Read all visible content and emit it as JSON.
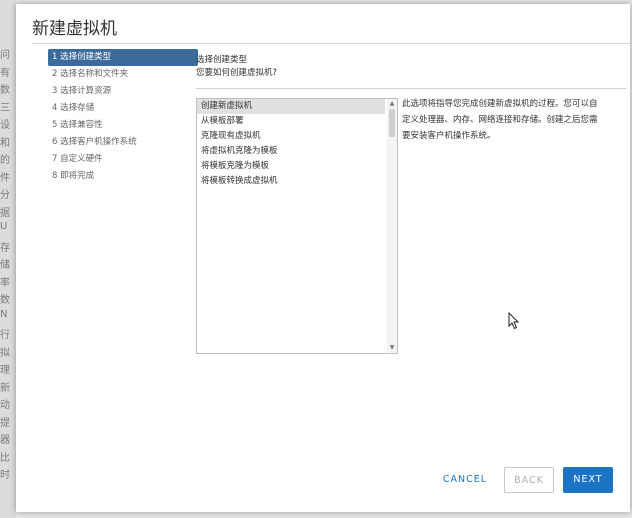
{
  "background_strip": [
    "问",
    "有",
    "数",
    "三",
    "设",
    "和",
    "的",
    "件",
    "分",
    "据",
    "U",
    "存",
    "储",
    "率",
    "数",
    "N",
    "行",
    "拟",
    "理",
    "新",
    "动",
    "提",
    "器",
    "比",
    "时"
  ],
  "dialog": {
    "title": "新建虚拟机"
  },
  "steps": [
    {
      "label": "1 选择创建类型",
      "active": true
    },
    {
      "label": "2 选择名称和文件夹",
      "active": false
    },
    {
      "label": "3 选择计算资源",
      "active": false
    },
    {
      "label": "4 选择存储",
      "active": false
    },
    {
      "label": "5 选择兼容性",
      "active": false
    },
    {
      "label": "6 选择客户机操作系统",
      "active": false
    },
    {
      "label": "7 自定义硬件",
      "active": false
    },
    {
      "label": "8 即将完成",
      "active": false
    }
  ],
  "content": {
    "title": "选择创建类型",
    "subtitle": "您要如何创建虚拟机?"
  },
  "creation_types": [
    {
      "label": "创建新虚拟机",
      "selected": true
    },
    {
      "label": "从模板部署",
      "selected": false
    },
    {
      "label": "克隆现有虚拟机",
      "selected": false
    },
    {
      "label": "将虚拟机克隆为模板",
      "selected": false
    },
    {
      "label": "将模板克隆为模板",
      "selected": false
    },
    {
      "label": "将模板转换成虚拟机",
      "selected": false
    }
  ],
  "description": "此选项将指导您完成创建新虚拟机的过程。您可以自定义处理器、内存、网络连接和存储。创建之后您需要安装客户机操作系统。",
  "buttons": {
    "cancel": "CANCEL",
    "back": "BACK",
    "next": "NEXT"
  },
  "colors": {
    "accent": "#1d73c4",
    "active_step": "#3a6b9a"
  }
}
